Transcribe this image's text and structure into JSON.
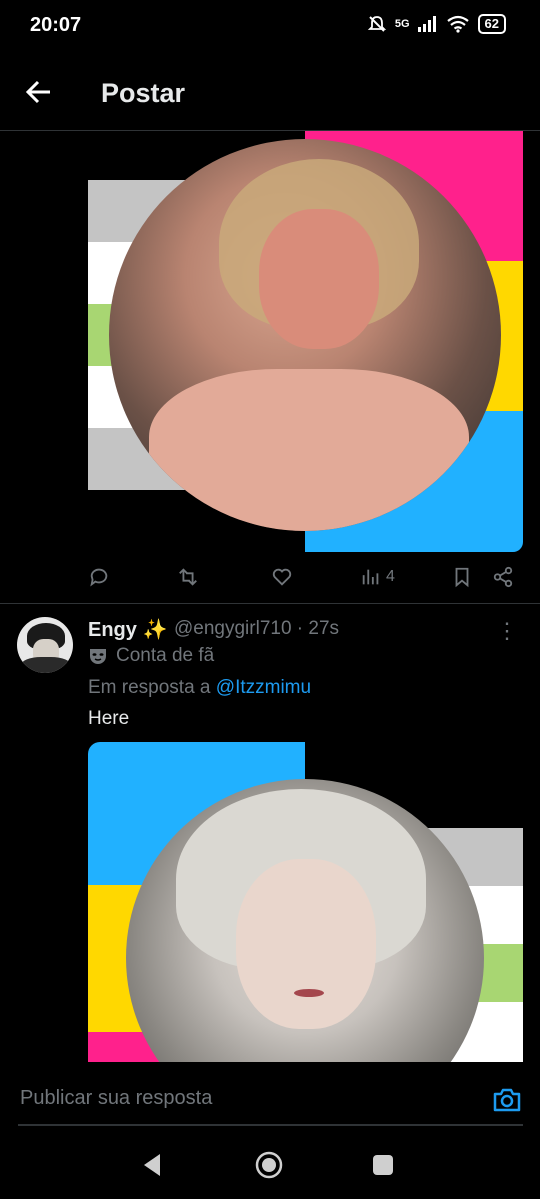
{
  "status": {
    "time": "20:07",
    "network": "5G",
    "battery": "62"
  },
  "header": {
    "title": "Postar",
    "back_icon": "arrow-left-icon"
  },
  "first_post": {
    "actions": {
      "views": "4"
    },
    "flag_stripes_top": [
      "#c4c4c4",
      "#ffffff",
      "#a8d672",
      "#ffffff",
      "#c4c4c4"
    ],
    "flag_right_colors": [
      "#ff218c",
      "#ffd800",
      "#21b1ff"
    ]
  },
  "reply": {
    "name": "Engy ✨",
    "handle": "@engygirl710 · 27s",
    "badge": "Conta de fã",
    "in_reply_prefix": "Em resposta a ",
    "mention": "@Itzzmimu",
    "text": "Here",
    "more_icon": "more-vertical-icon"
  },
  "composer": {
    "placeholder": "Publicar sua resposta"
  },
  "colors": {
    "accent": "#1d9bf0",
    "muted": "#71767b",
    "divider": "#2f3336"
  }
}
